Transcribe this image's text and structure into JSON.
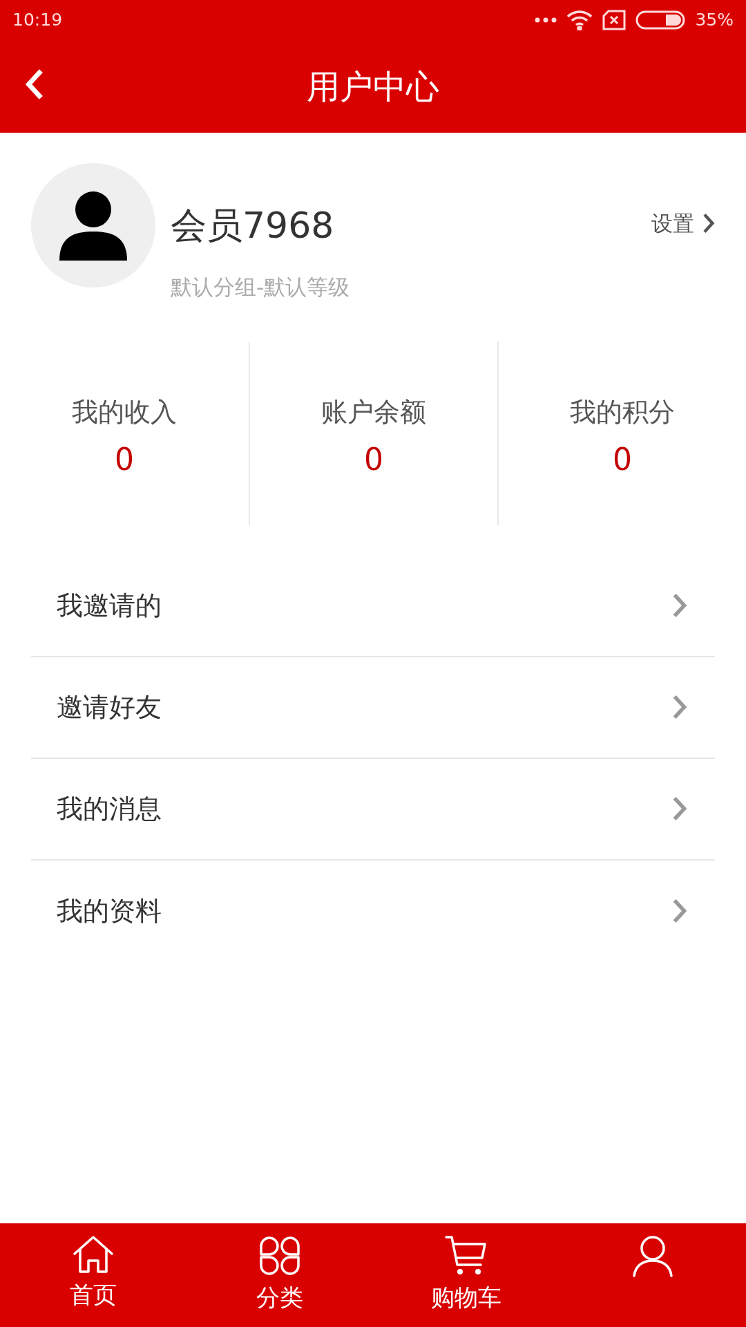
{
  "status_bar": {
    "time": "10:19",
    "battery": "35%"
  },
  "header": {
    "title": "用户中心"
  },
  "profile": {
    "name": "会员7968",
    "group": "默认分组-默认等级",
    "settings": "设置"
  },
  "stats": [
    {
      "label": "我的收入",
      "value": "0"
    },
    {
      "label": "账户余额",
      "value": "0"
    },
    {
      "label": "我的积分",
      "value": "0"
    }
  ],
  "menu": [
    {
      "label": "我邀请的"
    },
    {
      "label": "邀请好友"
    },
    {
      "label": "我的消息"
    },
    {
      "label": "我的资料"
    }
  ],
  "bottom_nav": [
    {
      "kind": "home",
      "label": "首页"
    },
    {
      "kind": "category",
      "label": "分类"
    },
    {
      "kind": "cart",
      "label": "购物车"
    },
    {
      "kind": "user"
    }
  ]
}
